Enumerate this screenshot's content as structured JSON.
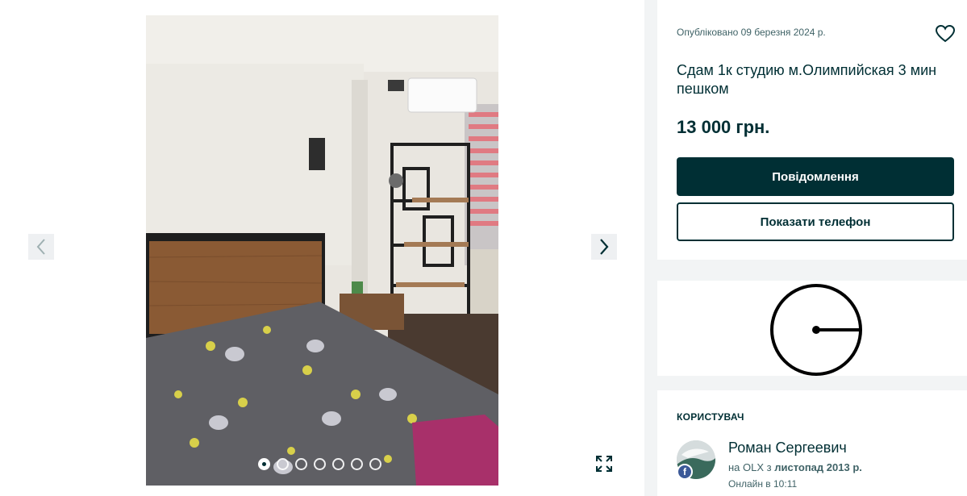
{
  "gallery": {
    "prev_icon": "chevron-left-icon",
    "next_icon": "chevron-right-icon",
    "fullscreen_icon": "expand-icon",
    "dots_count": 7,
    "active_dot": 1
  },
  "offer": {
    "published": "Опубліковано 09 березня 2024 р.",
    "favorite_icon": "heart-icon",
    "title": "Сдам 1к студию м.Олимпийская 3 мин пешком",
    "price": "13 000 грн.",
    "message_button": "Повідомлення",
    "phone_button": "Показати телефон"
  },
  "map": {
    "icon": "clock-icon"
  },
  "user": {
    "heading": "КОРИСТУВАЧ",
    "name": "Роман Сергеевич",
    "since_prefix": "на OLX з ",
    "since_date": "листопад 2013 р.",
    "online": "Онлайн в 10:11",
    "badge_letter": "f"
  },
  "colors": {
    "brand_dark": "#002f34",
    "muted_text": "#406367",
    "background": "#f2f4f5",
    "facebook": "#3b5998"
  }
}
